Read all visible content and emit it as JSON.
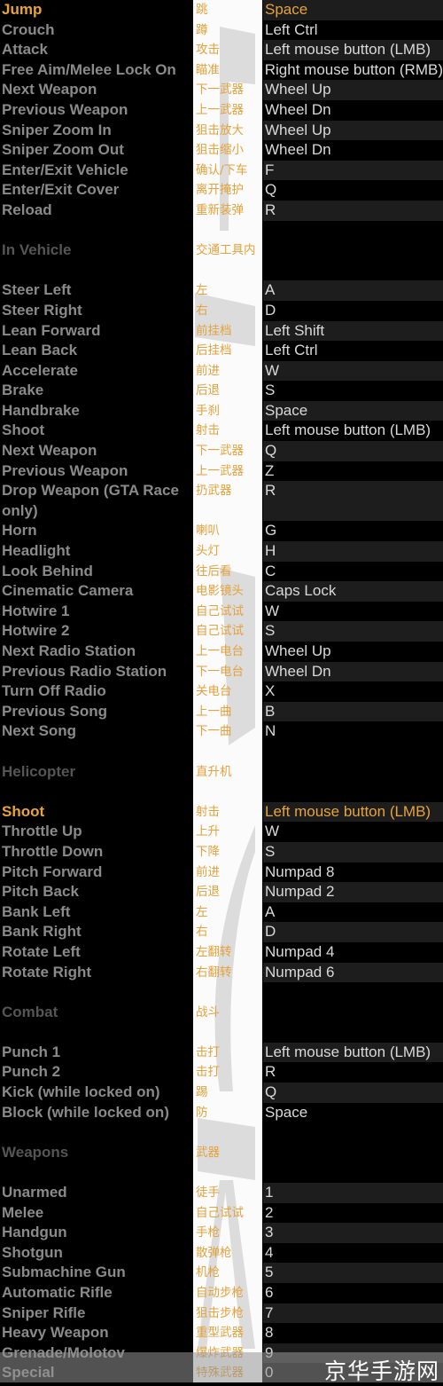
{
  "colors": {
    "background": "#000000",
    "action_text": "#8a8a8a",
    "highlight": "#e8a33a",
    "chinese_text": "#e3a23c",
    "key_text": "#d9d9d9",
    "row_shade": "#1d1d1d",
    "middle_column": "#fbfbfb"
  },
  "sections": [
    {
      "header": null,
      "rows": [
        {
          "action": "Jump",
          "zh": "跳",
          "key": "Space",
          "highlight": true
        },
        {
          "action": "Crouch",
          "zh": "蹲",
          "key": "Left Ctrl"
        },
        {
          "action": "Attack",
          "zh": "攻击",
          "key": "Left mouse button (LMB)"
        },
        {
          "action": "Free Aim/Melee Lock On",
          "zh": "瞄准",
          "key": "Right mouse button (RMB)"
        },
        {
          "action": "Next Weapon",
          "zh": "下一武器",
          "key": "Wheel Up"
        },
        {
          "action": "Previous Weapon",
          "zh": "上一武器",
          "key": "Wheel Dn"
        },
        {
          "action": "Sniper Zoom In",
          "zh": "狙击放大",
          "key": "Wheel Up"
        },
        {
          "action": "Sniper Zoom Out",
          "zh": "狙击缩小",
          "key": "Wheel Dn"
        },
        {
          "action": "Enter/Exit Vehicle",
          "zh": "确认/下车",
          "key": "F"
        },
        {
          "action": "Enter/Exit Cover",
          "zh": "离开掩护",
          "key": "Q"
        },
        {
          "action": "Reload",
          "zh": "重新装弹",
          "key": "R"
        }
      ]
    },
    {
      "header": {
        "en": "In Vehicle",
        "zh": "交通工具内"
      },
      "rows": [
        {
          "action": "Steer Left",
          "zh": "左",
          "key": "A"
        },
        {
          "action": "Steer Right",
          "zh": "右",
          "key": "D"
        },
        {
          "action": "Lean Forward",
          "zh": "前挂档",
          "key": "Left Shift"
        },
        {
          "action": "Lean Back",
          "zh": "后挂档",
          "key": "Left Ctrl"
        },
        {
          "action": "Accelerate",
          "zh": "前进",
          "key": "W"
        },
        {
          "action": "Brake",
          "zh": "后退",
          "key": "S"
        },
        {
          "action": "Handbrake",
          "zh": "手刹",
          "key": "Space"
        },
        {
          "action": "Shoot",
          "zh": "射击",
          "key": "Left mouse button (LMB)"
        },
        {
          "action": "Next Weapon",
          "zh": "下一武器",
          "key": "Q"
        },
        {
          "action": "Previous Weapon",
          "zh": "上一武器",
          "key": "Z"
        },
        {
          "action": "Drop Weapon (GTA Race only)",
          "zh": "扔武器",
          "key": "R"
        },
        {
          "action": "Horn",
          "zh": "喇叭",
          "key": "G"
        },
        {
          "action": "Headlight",
          "zh": "头灯",
          "key": "H"
        },
        {
          "action": "Look Behind",
          "zh": "往后看",
          "key": "C"
        },
        {
          "action": "Cinematic Camera",
          "zh": "电影镜头",
          "key": "Caps Lock"
        },
        {
          "action": "Hotwire 1",
          "zh": "自己试试",
          "key": "W"
        },
        {
          "action": "Hotwire 2",
          "zh": "自己试试",
          "key": "S"
        },
        {
          "action": "Next Radio Station",
          "zh": "上一电台",
          "key": "Wheel Up"
        },
        {
          "action": "Previous Radio Station",
          "zh": "下一电台",
          "key": "Wheel Dn"
        },
        {
          "action": "Turn Off Radio",
          "zh": "关电台",
          "key": "X"
        },
        {
          "action": "Previous Song",
          "zh": "上一曲",
          "key": "B"
        },
        {
          "action": "Next Song",
          "zh": "下一曲",
          "key": "N"
        }
      ]
    },
    {
      "header": {
        "en": "Helicopter",
        "zh": "直升机"
      },
      "rows": [
        {
          "action": "Shoot",
          "zh": "射击",
          "key": "Left mouse button (LMB)",
          "highlight": true
        },
        {
          "action": "Throttle Up",
          "zh": "上升",
          "key": "W"
        },
        {
          "action": "Throttle Down",
          "zh": "下降",
          "key": "S"
        },
        {
          "action": "Pitch Forward",
          "zh": "前进",
          "key": "Numpad 8"
        },
        {
          "action": "Pitch Back",
          "zh": "后退",
          "key": "Numpad 2"
        },
        {
          "action": "Bank Left",
          "zh": "左",
          "key": "A"
        },
        {
          "action": "Bank Right",
          "zh": "右",
          "key": "D"
        },
        {
          "action": "Rotate Left",
          "zh": "左翻转",
          "key": "Numpad 4"
        },
        {
          "action": "Rotate Right",
          "zh": "右翻转",
          "key": "Numpad 6"
        }
      ]
    },
    {
      "header": {
        "en": "Combat",
        "zh": "战斗"
      },
      "rows": [
        {
          "action": "Punch 1",
          "zh": "击打",
          "key": "Left mouse button (LMB)"
        },
        {
          "action": "Punch 2",
          "zh": "击打",
          "key": "R"
        },
        {
          "action": "Kick (while locked on)",
          "zh": "踢",
          "key": "Q"
        },
        {
          "action": "Block (while locked on)",
          "zh": "防",
          "key": "Space"
        }
      ]
    },
    {
      "header": {
        "en": "Weapons",
        "zh": "武器"
      },
      "rows": [
        {
          "action": "Unarmed",
          "zh": "徒手",
          "key": "1"
        },
        {
          "action": "Melee",
          "zh": "自己试试",
          "key": "2"
        },
        {
          "action": "Handgun",
          "zh": "手枪",
          "key": "3"
        },
        {
          "action": "Shotgun",
          "zh": "散弹枪",
          "key": "4"
        },
        {
          "action": "Submachine Gun",
          "zh": "机枪",
          "key": "5"
        },
        {
          "action": "Automatic Rifle",
          "zh": "自动步枪",
          "key": "6"
        },
        {
          "action": "Sniper Rifle",
          "zh": "狙击步枪",
          "key": "7"
        },
        {
          "action": "Heavy Weapon",
          "zh": "重型武器",
          "key": "8"
        },
        {
          "action": "Grenade/Molotov",
          "zh": "爆炸武器",
          "key": "9"
        },
        {
          "action": "Special",
          "zh": "特殊武器",
          "key": "0"
        }
      ]
    }
  ],
  "watermark": {
    "text": "京华手游网"
  }
}
